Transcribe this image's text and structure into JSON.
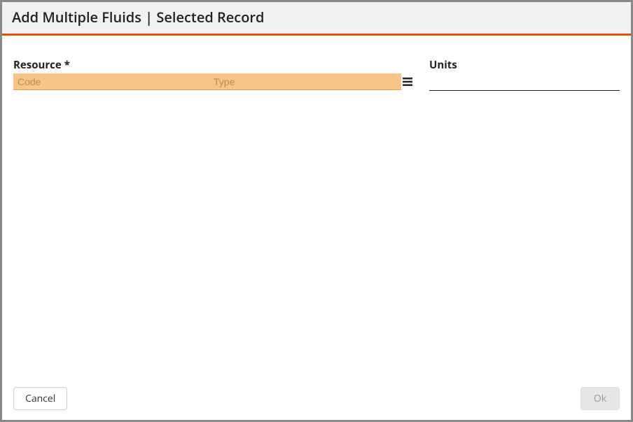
{
  "dialog": {
    "title": "Add Multiple Fluids | Selected Record"
  },
  "fields": {
    "resource": {
      "label": "Resource *",
      "code_placeholder": "Code",
      "code_value": "",
      "type_placeholder": "Type",
      "type_value": ""
    },
    "units": {
      "label": "Units",
      "value": ""
    }
  },
  "buttons": {
    "cancel": "Cancel",
    "ok": "Ok"
  }
}
